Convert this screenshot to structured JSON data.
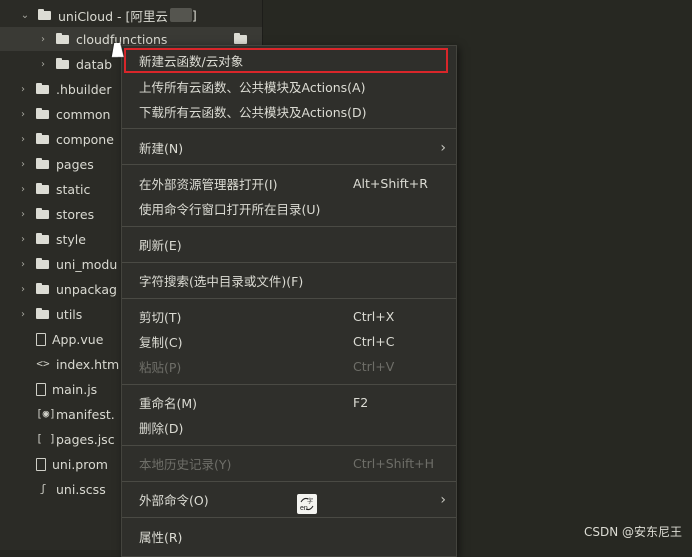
{
  "tree": {
    "root_label": "uniCloud - [阿里云",
    "root_suffix": "]",
    "items": [
      {
        "label": "cloudfunctions"
      },
      {
        "label": "datab"
      },
      {
        "label": ".hbuilder"
      },
      {
        "label": "common"
      },
      {
        "label": "compone"
      },
      {
        "label": "pages"
      },
      {
        "label": "static"
      },
      {
        "label": "stores"
      },
      {
        "label": "style"
      },
      {
        "label": "uni_modu"
      },
      {
        "label": "unpackag"
      },
      {
        "label": "utils"
      },
      {
        "label": "App.vue"
      },
      {
        "label": "index.htm"
      },
      {
        "label": "main.js"
      },
      {
        "label": "manifest."
      },
      {
        "label": "pages.jsc"
      },
      {
        "label": "uni.prom"
      },
      {
        "label": "uni.scss"
      }
    ]
  },
  "menu": {
    "items": [
      {
        "label": "新建云函数/云对象",
        "shortcut": ""
      },
      {
        "label": "上传所有云函数、公共模块及Actions(A)",
        "shortcut": ""
      },
      {
        "label": "下载所有云函数、公共模块及Actions(D)",
        "shortcut": ""
      },
      {
        "label": "新建(N)",
        "shortcut": ""
      },
      {
        "label": "在外部资源管理器打开(I)",
        "shortcut": "Alt+Shift+R"
      },
      {
        "label": "使用命令行窗口打开所在目录(U)",
        "shortcut": ""
      },
      {
        "label": "刷新(E)",
        "shortcut": ""
      },
      {
        "label": "字符搜索(选中目录或文件)(F)",
        "shortcut": ""
      },
      {
        "label": "剪切(T)",
        "shortcut": "Ctrl+X"
      },
      {
        "label": "复制(C)",
        "shortcut": "Ctrl+C"
      },
      {
        "label": "粘贴(P)",
        "shortcut": "Ctrl+V"
      },
      {
        "label": "重命名(M)",
        "shortcut": "F2"
      },
      {
        "label": "删除(D)",
        "shortcut": ""
      },
      {
        "label": "本地历史记录(Y)",
        "shortcut": "Ctrl+Shift+H"
      },
      {
        "label": "外部命令(O)",
        "shortcut": ""
      },
      {
        "label": "属性(R)",
        "shortcut": ""
      }
    ]
  },
  "watermark": "CSDN @安东尼王",
  "colors": {
    "highlight_border": "#d9262a",
    "menu_bg": "#2f2f2b",
    "editor_bg": "#272822"
  }
}
